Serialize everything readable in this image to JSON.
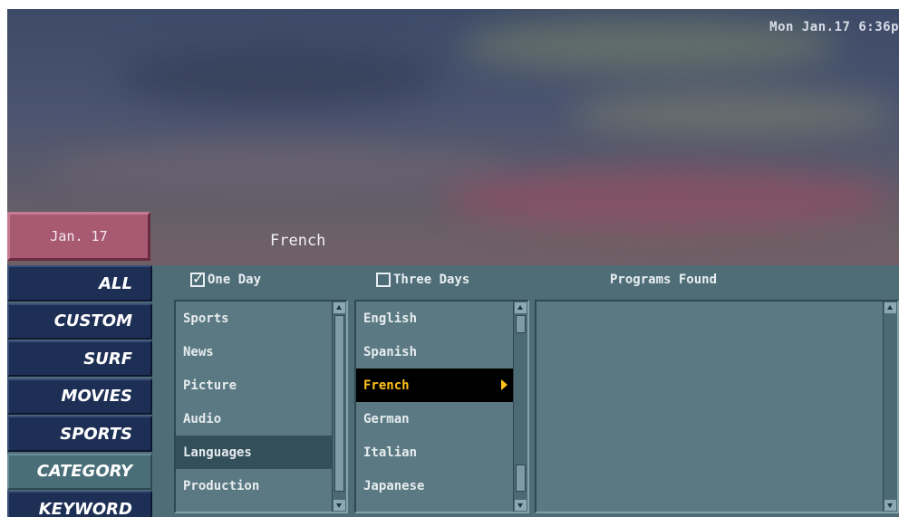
{
  "header": {
    "clock": "Mon Jan.17  6:36p",
    "date": "Jan. 17",
    "selected_category": "French"
  },
  "sidebar": {
    "items": [
      {
        "label": "ALL",
        "active": false
      },
      {
        "label": "CUSTOM",
        "active": false
      },
      {
        "label": "SURF",
        "active": false
      },
      {
        "label": "MOVIES",
        "active": false
      },
      {
        "label": "SPORTS",
        "active": false
      },
      {
        "label": "CATEGORY",
        "active": true
      },
      {
        "label": "KEYWORD",
        "active": false
      }
    ]
  },
  "filters": {
    "one_day": {
      "label": "One Day",
      "checked": true
    },
    "three_days": {
      "label": "Three Days",
      "checked": false
    }
  },
  "categories": {
    "items": [
      "Sports",
      "News",
      "Picture",
      "Audio",
      "Languages",
      "Production"
    ],
    "highlighted": "Languages"
  },
  "subcategories": {
    "items": [
      "English",
      "Spanish",
      "French",
      "German",
      "Italian",
      "Japanese"
    ],
    "selected": "French"
  },
  "programs": {
    "title": "Programs Found",
    "items": []
  },
  "colors": {
    "sidebar_button": "#1e2f55",
    "panel": "#4f6d76",
    "selection_text": "#ffc21a",
    "date_box": "#a85a72"
  }
}
